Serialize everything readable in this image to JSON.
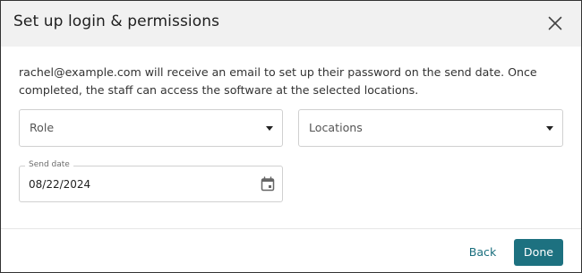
{
  "dialog": {
    "title": "Set up login & permissions",
    "close_icon": "close-icon",
    "message": "rachel@example.com will receive an email to set up their password on the send date. Once completed, the staff can access the software at the selected locations."
  },
  "form": {
    "role": {
      "placeholder": "Role",
      "icon": "caret-down-icon"
    },
    "locations": {
      "placeholder": "Locations",
      "icon": "caret-down-icon"
    },
    "send_date": {
      "label": "Send date",
      "value": "08/22/2024",
      "icon": "calendar-icon"
    }
  },
  "footer": {
    "back_label": "Back",
    "done_label": "Done"
  },
  "colors": {
    "header_bg": "#f1f1f1",
    "accent": "#1d7180",
    "link": "#1b6f7e",
    "border": "#d0d0d0",
    "text": "#333333"
  }
}
